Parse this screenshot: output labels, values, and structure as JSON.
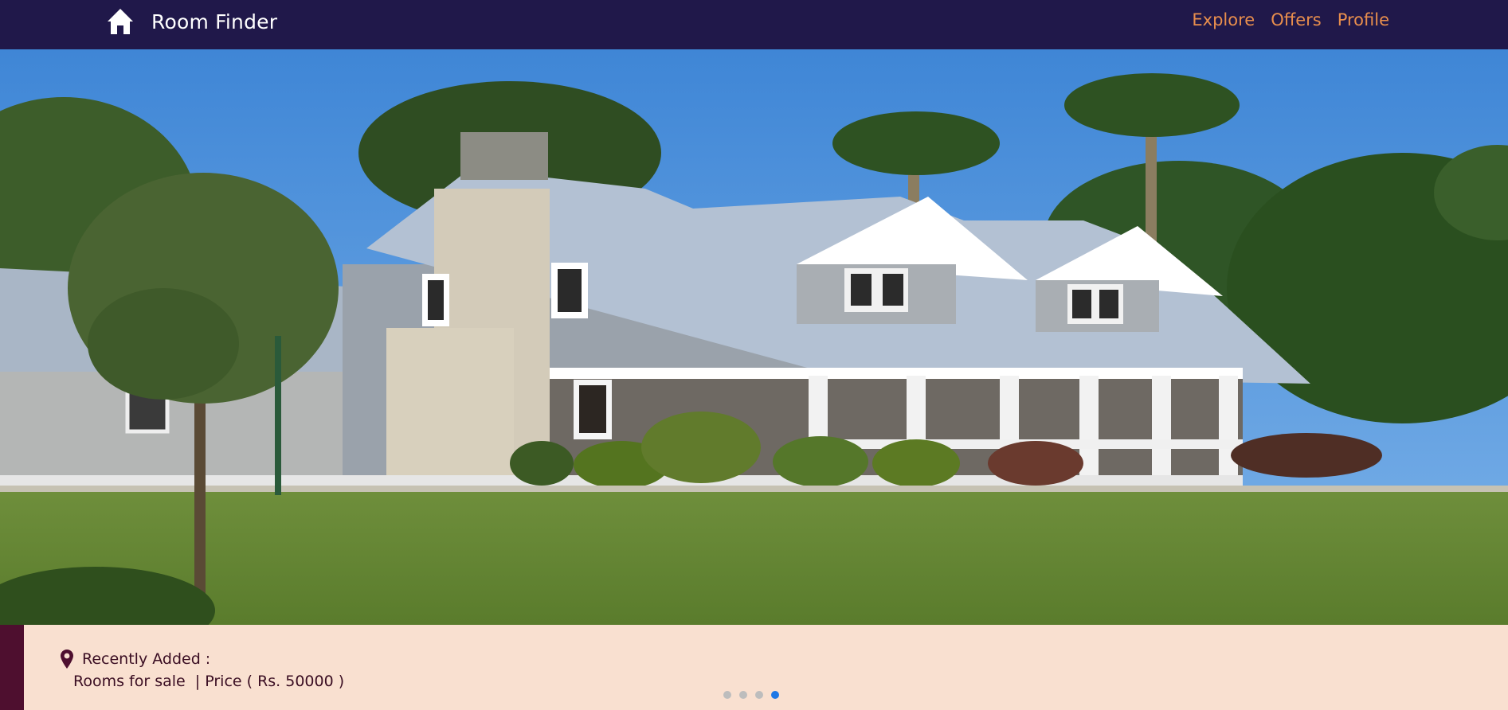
{
  "brand": {
    "title": "Room Finder",
    "icon": "home-icon"
  },
  "nav": {
    "links": [
      "Explore",
      "Offers",
      "Profile"
    ]
  },
  "hero": {
    "alt": "House with lawn"
  },
  "listing": {
    "icon": "location-pin-icon",
    "label": "Recently Added :",
    "details": "Rooms for sale  | Price ( Rs. 50000 )"
  },
  "carousel": {
    "total_slides": 4,
    "active_slide": 4
  },
  "colors": {
    "navbar": "#20184a",
    "nav_link": "#e88e4d",
    "info_bg": "#f9e0d0",
    "info_strip": "#4e0f2f",
    "dot_active": "#1e78e6",
    "dot_inactive": "#bdbdbd"
  }
}
